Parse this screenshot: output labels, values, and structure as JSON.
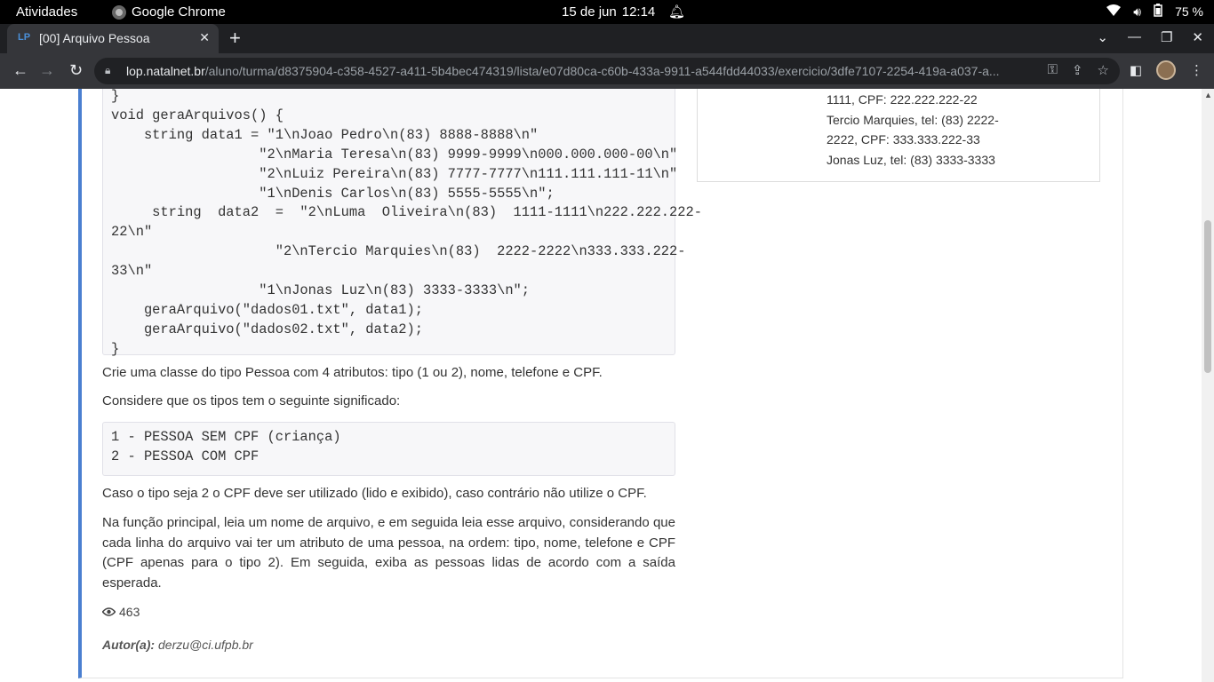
{
  "system_bar": {
    "activities": "Atividades",
    "app_name": "Google Chrome",
    "date": "15 de jun",
    "time": "12:14",
    "battery": "75 %"
  },
  "browser": {
    "tab_title": "[00] Arquivo Pessoa",
    "url_host": "lop.natalnet.br",
    "url_path": "/aluno/turma/d8375904-c358-4527-a411-5b4bec474319/lista/e07d80ca-c60b-433a-9911-a544fdd44033/exercicio/3dfe7107-2254-419a-a037-a..."
  },
  "icons": {
    "bell": "bell-icon",
    "wifi": "wifi-icon",
    "volume": "volume-icon",
    "battery": "battery-icon",
    "back": "back-arrow-icon",
    "forward": "forward-arrow-icon",
    "reload": "reload-icon",
    "lock": "lock-icon",
    "key": "key-icon",
    "share": "share-icon",
    "star": "star-icon",
    "sidepanel": "side-panel-icon",
    "menu": "kebab-menu-icon",
    "eye": "eye-icon"
  },
  "content": {
    "code_block_1": "}\nvoid geraArquivos() {\n    string data1 = \"1\\nJoao Pedro\\n(83) 8888-8888\\n\"\n                  \"2\\nMaria Teresa\\n(83) 9999-9999\\n000.000.000-00\\n\"\n                  \"2\\nLuiz Pereira\\n(83) 7777-7777\\n111.111.111-11\\n\"\n                  \"1\\nDenis Carlos\\n(83) 5555-5555\\n\";\n     string  data2  =  \"2\\nLuma  Oliveira\\n(83)  1111-1111\\n222.222.222-\n22\\n\"\n                    \"2\\nTercio Marquies\\n(83)  2222-2222\\n333.333.222-\n33\\n\"\n                  \"1\\nJonas Luz\\n(83) 3333-3333\\n\";\n    geraArquivo(\"dados01.txt\", data1);\n    geraArquivo(\"dados02.txt\", data2);\n}",
    "paragraph_class": "Crie uma classe do tipo Pessoa com 4 atributos: tipo (1 ou 2), nome, telefone e CPF.",
    "paragraph_types": "Considere que os tipos tem o seguinte significado:",
    "code_block_2": "1 - PESSOA SEM CPF (criança)\n2 - PESSOA COM CPF",
    "paragraph_cpf": "Caso o tipo seja 2 o CPF deve ser utilizado (lido e exibido), caso contrário não utilize o CPF.",
    "paragraph_main": "Na função principal, leia um nome de arquivo, e em seguida leia esse arquivo, considerando que cada linha do arquivo vai ter um atributo de uma pessoa, na ordem: tipo, nome, telefone e CPF (CPF apenas para o tipo 2). Em seguida, exiba as pessoas lidas de acordo com a saída esperada.",
    "views_count": "463",
    "author_label": "Autor(a):",
    "author_email": "derzu@ci.ufpb.br"
  },
  "side_panel": {
    "lines": [
      "1111, CPF: 222.222.222-22",
      "Tercio Marquies, tel: (83) 2222-",
      "2222, CPF: 333.333.222-33",
      "Jonas Luz, tel: (83) 3333-3333"
    ]
  }
}
